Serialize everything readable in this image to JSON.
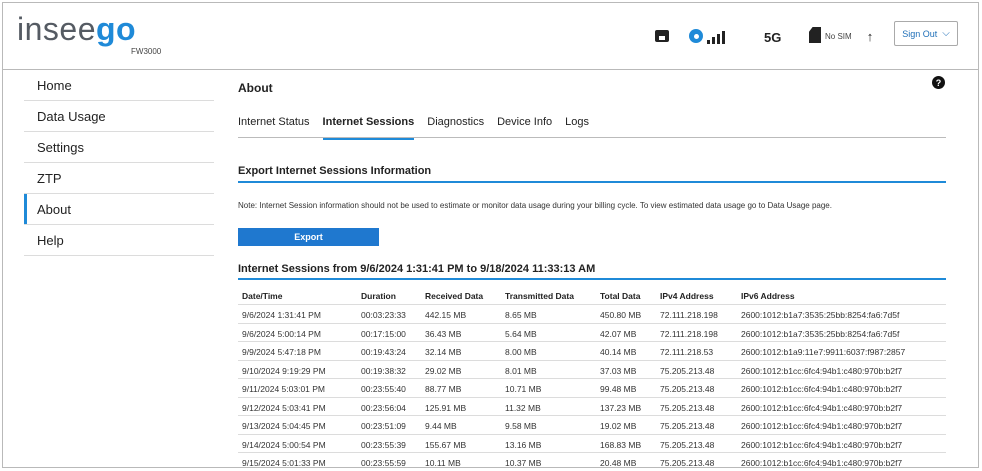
{
  "brand": {
    "logo_part1": "insee",
    "logo_part2": "go",
    "model": "FW3000"
  },
  "status_bar": {
    "ethernet_icon": "ethernet-icon",
    "wifi_icon": "wifi-icon",
    "signal_icon": "signal-bars-icon",
    "network_type": "5G",
    "sim_icon": "sim-card-icon",
    "sim_status": "No SIM",
    "arrow_icon": "up-arrow-icon",
    "sign_out": "Sign Out"
  },
  "sidebar": {
    "items": [
      {
        "label": "Home"
      },
      {
        "label": "Data Usage"
      },
      {
        "label": "Settings"
      },
      {
        "label": "ZTP"
      },
      {
        "label": "About"
      },
      {
        "label": "Help"
      }
    ]
  },
  "page": {
    "title": "About",
    "help": "?",
    "tabs": [
      {
        "label": "Internet Status"
      },
      {
        "label": "Internet Sessions"
      },
      {
        "label": "Diagnostics"
      },
      {
        "label": "Device Info"
      },
      {
        "label": "Logs"
      }
    ],
    "export_title": "Export Internet Sessions Information",
    "note": "Note: Internet Session information should not be used to estimate or monitor data usage during your billing cycle. To view estimated data usage go to Data Usage page.",
    "export_button": "Export",
    "sessions_title": "Internet Sessions from 9/6/2024 1:31:41 PM to 9/18/2024 11:33:13 AM"
  },
  "table": {
    "headers": [
      "Date/Time",
      "Duration",
      "Received Data",
      "Transmitted Data",
      "Total Data",
      "IPv4 Address",
      "IPv6 Address"
    ],
    "rows": [
      [
        "9/6/2024 1:31:41 PM",
        "00:03:23:33",
        "442.15 MB",
        "8.65 MB",
        "450.80 MB",
        "72.111.218.198",
        "2600:1012:b1a7:3535:25bb:8254:fa6:7d5f"
      ],
      [
        "9/6/2024 5:00:14 PM",
        "00:17:15:00",
        "36.43 MB",
        "5.64 MB",
        "42.07 MB",
        "72.111.218.198",
        "2600:1012:b1a7:3535:25bb:8254:fa6:7d5f"
      ],
      [
        "9/9/2024 5:47:18 PM",
        "00:19:43:24",
        "32.14 MB",
        "8.00 MB",
        "40.14 MB",
        "72.111.218.53",
        "2600:1012:b1a9:11e7:9911:6037:f987:2857"
      ],
      [
        "9/10/2024 9:19:29 PM",
        "00:19:38:32",
        "29.02 MB",
        "8.01 MB",
        "37.03 MB",
        "75.205.213.48",
        "2600:1012:b1cc:6fc4:94b1:c480:970b:b2f7"
      ],
      [
        "9/11/2024 5:03:01 PM",
        "00:23:55:40",
        "88.77 MB",
        "10.71 MB",
        "99.48 MB",
        "75.205.213.48",
        "2600:1012:b1cc:6fc4:94b1:c480:970b:b2f7"
      ],
      [
        "9/12/2024 5:03:41 PM",
        "00:23:56:04",
        "125.91 MB",
        "11.32 MB",
        "137.23 MB",
        "75.205.213.48",
        "2600:1012:b1cc:6fc4:94b1:c480:970b:b2f7"
      ],
      [
        "9/13/2024 5:04:45 PM",
        "00:23:51:09",
        "9.44 MB",
        "9.58 MB",
        "19.02 MB",
        "75.205.213.48",
        "2600:1012:b1cc:6fc4:94b1:c480:970b:b2f7"
      ],
      [
        "9/14/2024 5:00:54 PM",
        "00:23:55:39",
        "155.67 MB",
        "13.16 MB",
        "168.83 MB",
        "75.205.213.48",
        "2600:1012:b1cc:6fc4:94b1:c480:970b:b2f7"
      ],
      [
        "9/15/2024 5:01:33 PM",
        "00:23:55:59",
        "10.11 MB",
        "10.37 MB",
        "20.48 MB",
        "75.205.213.48",
        "2600:1012:b1cc:6fc4:94b1:c480:970b:b2f7"
      ]
    ]
  },
  "colors": {
    "accent": "#1f8ad8",
    "button": "#1f78cf",
    "logo_gray": "#555b63"
  }
}
